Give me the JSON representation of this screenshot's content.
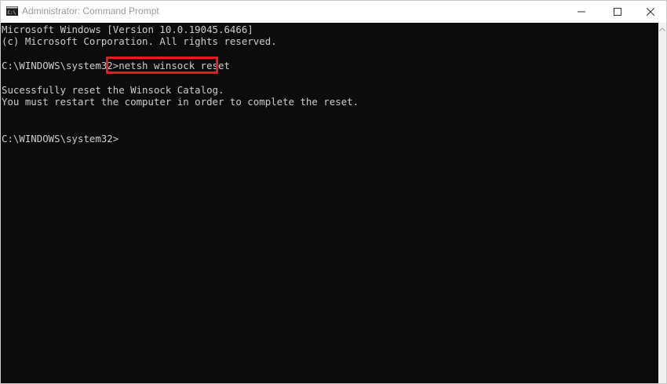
{
  "window": {
    "title": "Administrator: Command Prompt",
    "icon": "cmd-app-icon"
  },
  "titlebar_buttons": {
    "minimize_icon": "minimize-icon",
    "maximize_icon": "maximize-icon",
    "close_icon": "close-icon"
  },
  "console": {
    "lines": [
      "Microsoft Windows [Version 10.0.19045.6466]",
      "(c) Microsoft Corporation. All rights reserved.",
      "",
      "C:\\WINDOWS\\system32>netsh winsock reset",
      "",
      "Sucessfully reset the Winsock Catalog.",
      "You must restart the computer in order to complete the reset.",
      "",
      "",
      "C:\\WINDOWS\\system32>"
    ]
  },
  "colors": {
    "console_bg": "#0c0c0c",
    "console_text": "#cccccc",
    "highlight_border": "#e02020",
    "title_text": "#9a9a9a"
  }
}
